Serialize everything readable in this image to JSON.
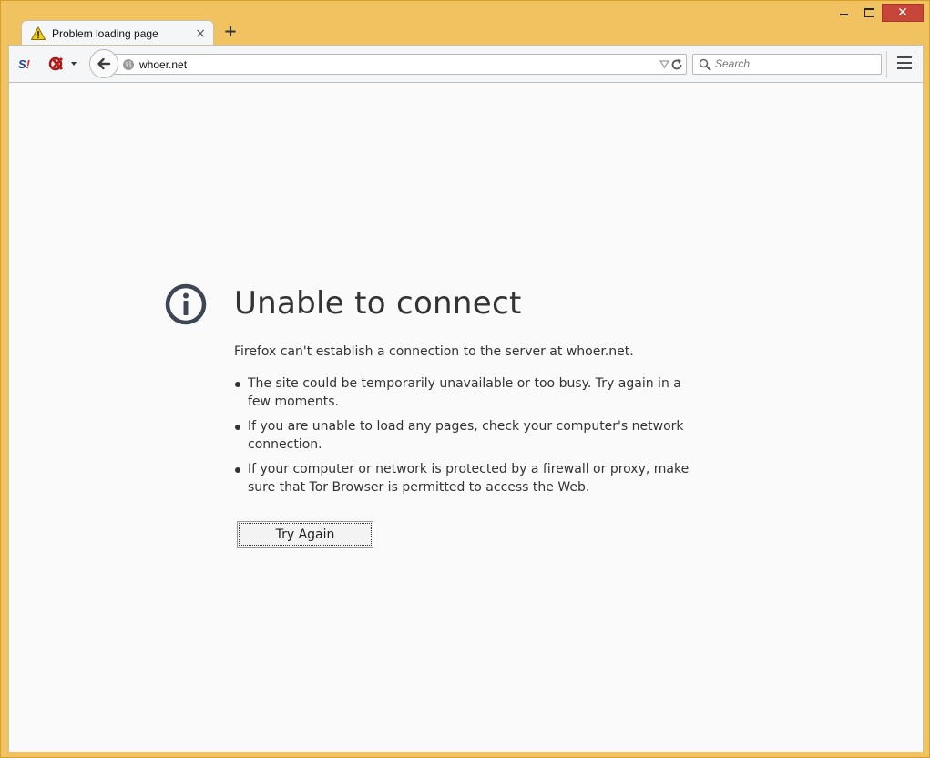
{
  "window": {
    "minimize_label": "",
    "maximize_label": "",
    "close_label": "✕"
  },
  "tab": {
    "title": "Problem loading page",
    "close_label": "×",
    "new_tab_label": "+"
  },
  "toolbar": {
    "url": "whoer.net",
    "search_placeholder": "Search"
  },
  "error_page": {
    "title": "Unable to connect",
    "description": "Firefox can't establish a connection to the server at whoer.net.",
    "bullets": [
      "The site could be temporarily unavailable or too busy. Try again in a few moments.",
      "If you are unable to load any pages, check your computer's network connection.",
      "If your computer or network is protected by a firewall or proxy, make sure that Tor Browser is permitted to access the Web."
    ],
    "try_again_label": "Try Again"
  },
  "colors": {
    "window_frame": "#f0c260",
    "close_button": "#c7463a",
    "content_bg": "#fafafa",
    "text": "#333333"
  }
}
